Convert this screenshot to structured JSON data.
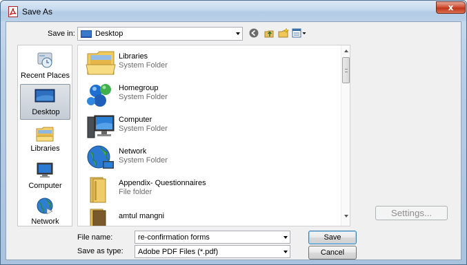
{
  "window": {
    "title": "Save As",
    "close_label": "x"
  },
  "toolbar": {
    "save_in_label": "Save in:",
    "save_in_value": "Desktop",
    "icons": [
      "back-icon",
      "up-folder-icon",
      "new-folder-icon",
      "view-menu-icon"
    ]
  },
  "places": [
    {
      "label": "Recent Places",
      "icon": "recent-places-icon"
    },
    {
      "label": "Desktop",
      "icon": "desktop-icon",
      "selected": true
    },
    {
      "label": "Libraries",
      "icon": "libraries-icon"
    },
    {
      "label": "Computer",
      "icon": "computer-icon"
    },
    {
      "label": "Network",
      "icon": "network-icon"
    }
  ],
  "files": [
    {
      "name": "Libraries",
      "type": "System Folder",
      "icon": "libraries-folder-icon"
    },
    {
      "name": "Homegroup",
      "type": "System Folder",
      "icon": "homegroup-icon"
    },
    {
      "name": "Computer",
      "type": "System Folder",
      "icon": "computer-icon"
    },
    {
      "name": "Network",
      "type": "System Folder",
      "icon": "network-globe-icon"
    },
    {
      "name": "Appendix- Questionnaires",
      "type": "File folder",
      "icon": "folder-icon"
    },
    {
      "name": "amtul mangni",
      "type": "",
      "icon": "folder-icon"
    }
  ],
  "form": {
    "file_name_label": "File name:",
    "file_name_value": "re-confirmation forms",
    "save_as_type_label": "Save as type:",
    "save_as_type_value": "Adobe PDF Files (*.pdf)"
  },
  "buttons": {
    "save": "Save",
    "cancel": "Cancel",
    "settings": "Settings..."
  },
  "colors": {
    "title_gradient": "#c5d9ee",
    "close_button": "#c1351a",
    "disabled_text": "#8d8d8d",
    "secondary_text": "#6d6d6d"
  }
}
